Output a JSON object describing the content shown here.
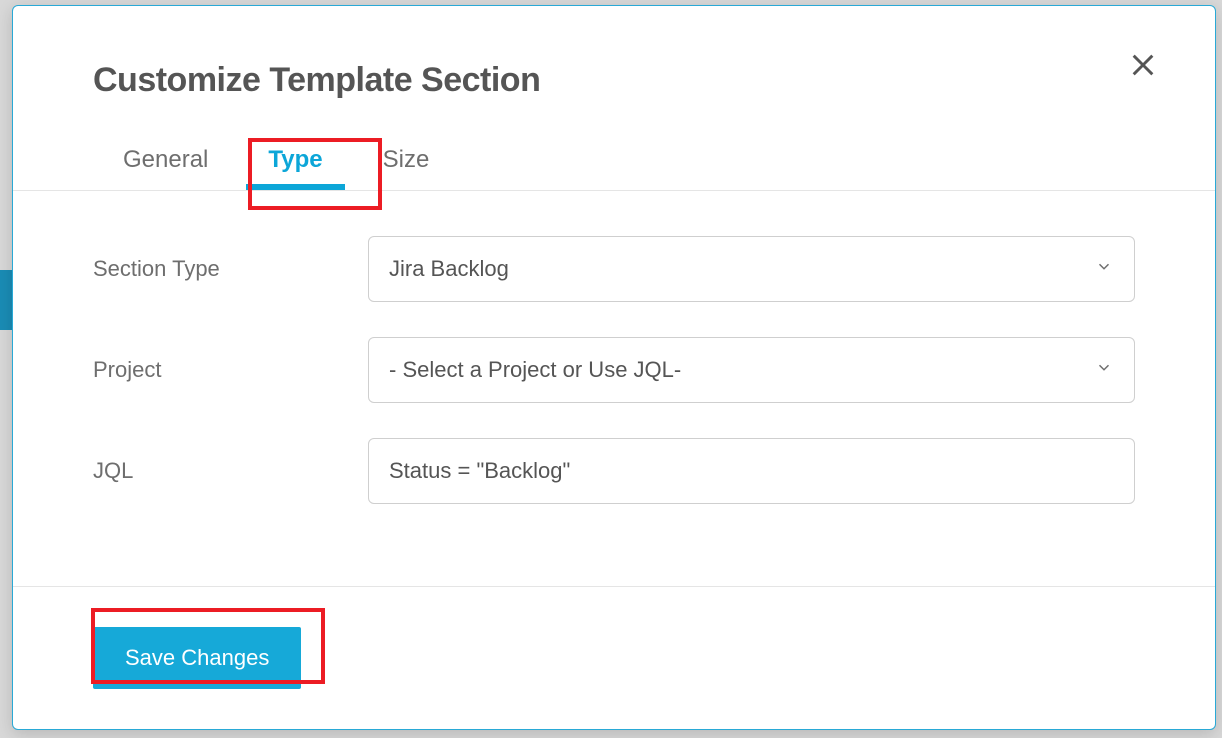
{
  "modal": {
    "title": "Customize Template Section",
    "tabs": [
      {
        "label": "General",
        "active": false
      },
      {
        "label": "Type",
        "active": true
      },
      {
        "label": "Size",
        "active": false
      }
    ],
    "form": {
      "section_type": {
        "label": "Section Type",
        "value": "Jira Backlog"
      },
      "project": {
        "label": "Project",
        "value": "- Select a Project or Use JQL-"
      },
      "jql": {
        "label": "JQL",
        "value": "Status = \"Backlog\""
      }
    },
    "footer": {
      "save_label": "Save Changes"
    }
  }
}
